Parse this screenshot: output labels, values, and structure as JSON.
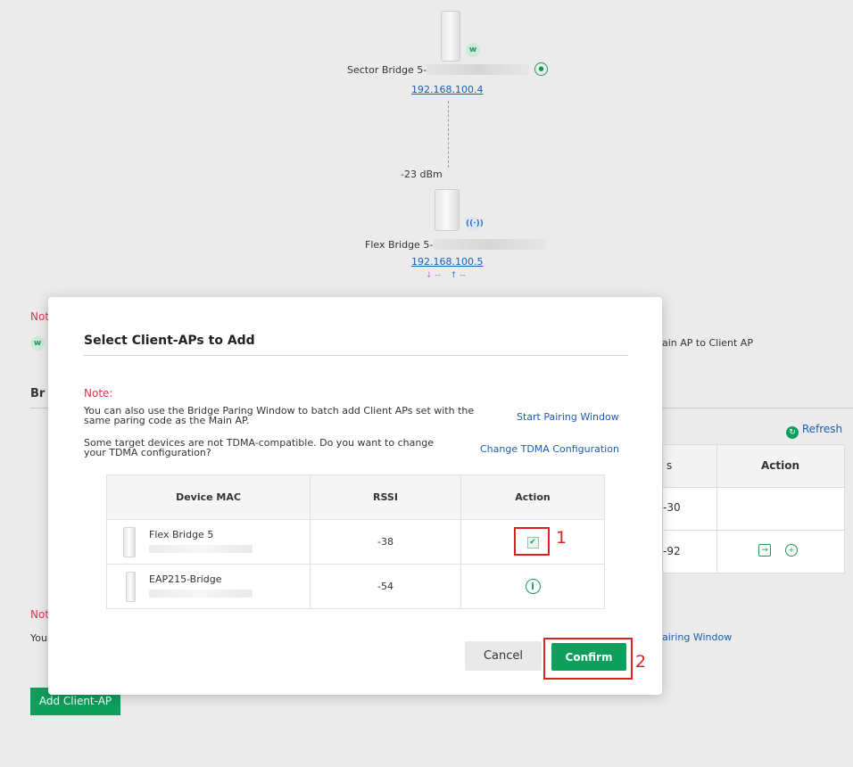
{
  "topology": {
    "main_ap": {
      "name": "Sector Bridge 5-",
      "ip": "192.168.100.4"
    },
    "client_ap": {
      "name": "Flex Bridge 5-",
      "ip": "192.168.100.5",
      "rssi": "-23 dBm",
      "down": "--",
      "up": "--"
    }
  },
  "background": {
    "note_1": "Not",
    "row_text": "ain AP to Client AP",
    "section": "Br",
    "refresh": "Refresh",
    "action_header": "Action",
    "col_header_fragment": "s",
    "row1_value": "-30",
    "row2_value": "-92",
    "note_2": "Not",
    "note_2_text": "You",
    "pairing_link": "airing Window",
    "add_client_ap": "Add Client-AP"
  },
  "modal": {
    "title": "Select Client-APs to Add",
    "note_label": "Note:",
    "note_line1": "You can also use the Bridge Paring Window to batch add Client APs set with the same paring code as the Main AP.",
    "note_line2": "Some target devices are not TDMA-compatible. Do you want to change your TDMA configuration?",
    "start_pairing": "Start Pairing Window",
    "change_tdma": "Change TDMA Configuration",
    "table": {
      "headers": [
        "Device MAC",
        "RSSI",
        "Action"
      ],
      "rows": [
        {
          "name": "Flex Bridge 5",
          "rssi": "-38",
          "action": "checkbox-checked"
        },
        {
          "name": "EAP215-Bridge",
          "rssi": "-54",
          "action": "info-icon"
        }
      ]
    },
    "cancel": "Cancel",
    "confirm": "Confirm"
  },
  "callouts": [
    "1",
    "2"
  ],
  "colors": {
    "accent": "#0e9f5c",
    "note_red": "#d9364f",
    "link": "#1a5db3",
    "callout": "#e02020"
  }
}
